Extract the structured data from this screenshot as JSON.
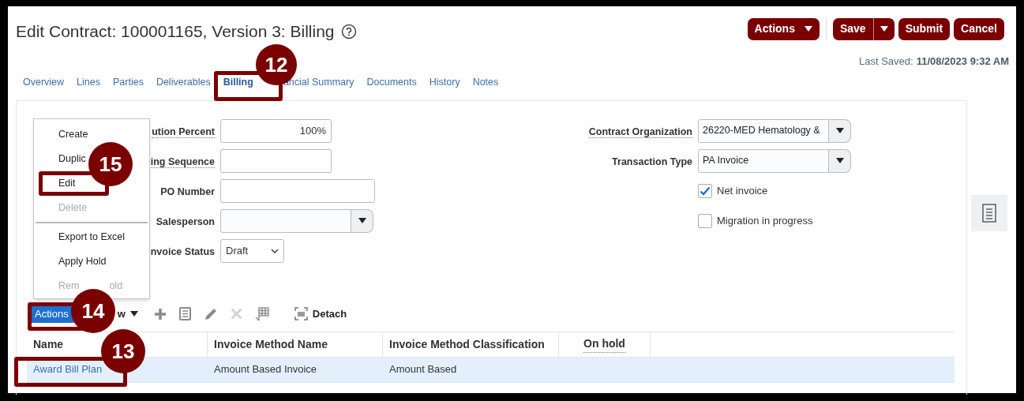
{
  "title": "Edit Contract: 100001165, Version 3: Billing",
  "header_buttons": [
    {
      "label": "Actions",
      "kind": "menu"
    },
    {
      "label": "Save",
      "kind": "split"
    },
    {
      "label": "Submit",
      "kind": "plain"
    },
    {
      "label": "Cancel",
      "kind": "plain"
    }
  ],
  "last_saved": {
    "label": "Last Saved:",
    "value": "11/08/2023 9:32 AM"
  },
  "tabs": [
    {
      "label": "Overview",
      "selected": false
    },
    {
      "label": "Lines",
      "selected": false
    },
    {
      "label": "Parties",
      "selected": false
    },
    {
      "label": "Deliverables",
      "selected": false
    },
    {
      "label": "Billing",
      "selected": true
    },
    {
      "label": "ancial Summary",
      "selected": false
    },
    {
      "label": "Documents",
      "selected": false
    },
    {
      "label": "History",
      "selected": false
    },
    {
      "label": "Notes",
      "selected": false
    }
  ],
  "form_left": [
    {
      "kind": "text",
      "label": "ution Percent",
      "hint": true,
      "value": "100%"
    },
    {
      "kind": "text",
      "label": "ing Sequence",
      "hint": true
    },
    {
      "kind": "text",
      "label": "PO Number",
      "hint": false
    },
    {
      "kind": "choice",
      "label": "Salesperson",
      "hint": false
    },
    {
      "kind": "select",
      "label": "nvoice Status",
      "hint": false,
      "value": "Draft"
    }
  ],
  "form_right": [
    {
      "kind": "choice",
      "label": "Contract Organization",
      "hint": true,
      "value": "26220-MED Hematology &"
    },
    {
      "kind": "choice",
      "label": "Transaction Type",
      "hint": false,
      "value": "PA Invoice"
    },
    {
      "kind": "checkbox",
      "label": "Net invoice",
      "checked": true
    },
    {
      "kind": "checkbox",
      "label": "Migration in progress",
      "checked": false
    }
  ],
  "toolbar": {
    "actions_label": "Actions",
    "view_label": "w",
    "tools": [
      {
        "kind": "add",
        "disabled": false
      },
      {
        "kind": "list",
        "disabled": false
      },
      {
        "kind": "edit",
        "disabled": false
      },
      {
        "kind": "delete",
        "disabled": true
      },
      {
        "kind": "freeze",
        "disabled": false
      }
    ],
    "detach_label": "Detach"
  },
  "table": {
    "columns": [
      {
        "label": "Name",
        "hint": false
      },
      {
        "label": "Invoice Method Name",
        "hint": false
      },
      {
        "label": "Invoice Method Classification",
        "hint": false
      },
      {
        "label": "On hold",
        "hint": true
      }
    ],
    "rows": [
      {
        "selected": true,
        "cells": [
          "Award Bill Plan",
          "Amount Based Invoice",
          "Amount Based",
          ""
        ]
      }
    ]
  },
  "menu": {
    "items": [
      {
        "kind": "item",
        "label": "Create",
        "disabled": false
      },
      {
        "kind": "item",
        "label": "Duplic",
        "disabled": false
      },
      {
        "kind": "item",
        "label": "Edit",
        "disabled": false
      },
      {
        "kind": "item",
        "label": "Delete",
        "disabled": true
      },
      {
        "kind": "separator"
      },
      {
        "kind": "item",
        "label": "Export to Excel",
        "disabled": false
      },
      {
        "kind": "item",
        "label": "Apply Hold",
        "disabled": false
      },
      {
        "kind": "split_item",
        "parts": [
          "Rem",
          "old"
        ],
        "disabled": true
      }
    ]
  },
  "callouts": [
    {
      "number": "12"
    },
    {
      "number": "15"
    },
    {
      "number": "14"
    },
    {
      "number": "13"
    }
  ]
}
